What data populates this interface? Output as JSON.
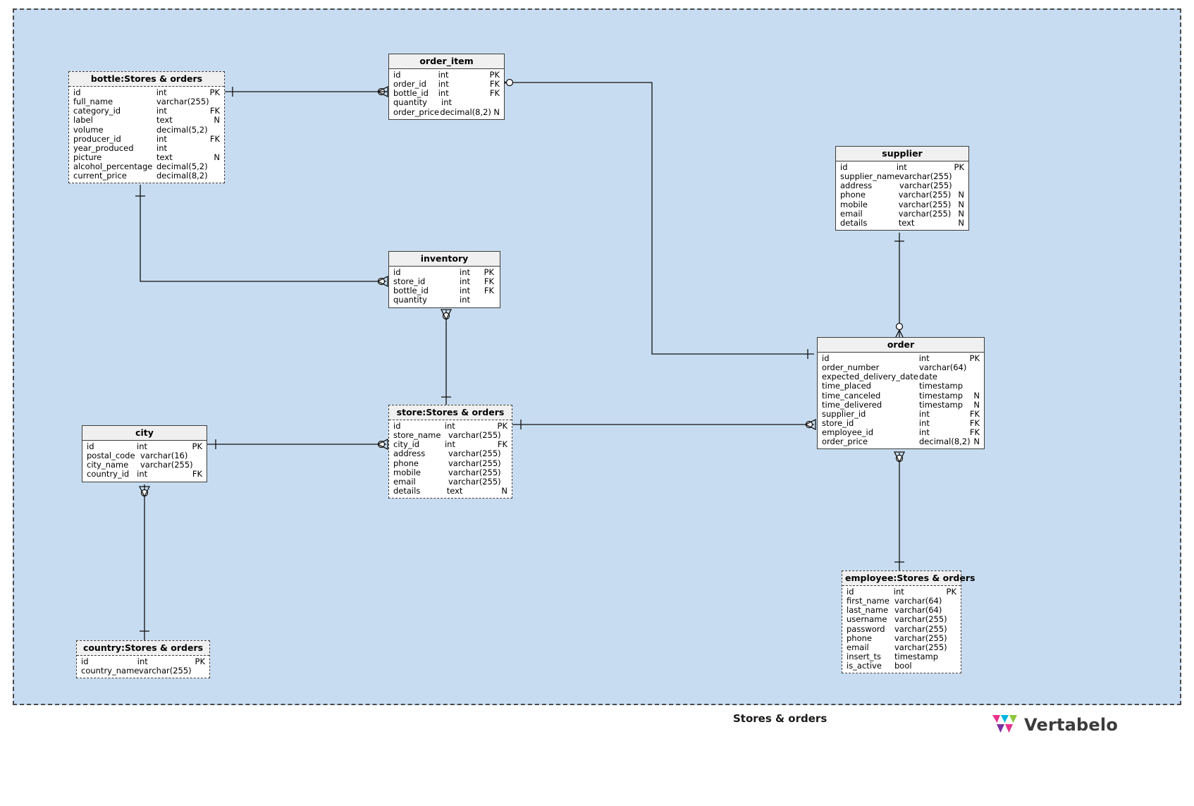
{
  "diagram": {
    "area_label": "Stores & orders",
    "background_color": "#c7dcf0",
    "border_style": "dashed",
    "brand": {
      "name": "Vertabelo",
      "logo_icon": "vertabelo-logo-icon",
      "colors": [
        "#e8318a",
        "#00b5e2",
        "#8dc63f",
        "#7b2fa0"
      ]
    }
  },
  "tables": {
    "bottle": {
      "title": "bottle:Stores & orders",
      "dashed": true,
      "columns": [
        {
          "name": "id",
          "type": "int",
          "key": "PK"
        },
        {
          "name": "full_name",
          "type": "varchar(255)",
          "key": ""
        },
        {
          "name": "category_id",
          "type": "int",
          "key": "FK"
        },
        {
          "name": "label",
          "type": "text",
          "key": "N"
        },
        {
          "name": "volume",
          "type": "decimal(5,2)",
          "key": ""
        },
        {
          "name": "producer_id",
          "type": "int",
          "key": "FK"
        },
        {
          "name": "year_produced",
          "type": "int",
          "key": ""
        },
        {
          "name": "picture",
          "type": "text",
          "key": "N"
        },
        {
          "name": "alcohol_percentage",
          "type": "decimal(5,2)",
          "key": ""
        },
        {
          "name": "current_price",
          "type": "decimal(8,2)",
          "key": ""
        }
      ]
    },
    "order_item": {
      "title": "order_item",
      "dashed": false,
      "columns": [
        {
          "name": "id",
          "type": "int",
          "key": "PK"
        },
        {
          "name": "order_id",
          "type": "int",
          "key": "FK"
        },
        {
          "name": "bottle_id",
          "type": "int",
          "key": "FK"
        },
        {
          "name": "quantity",
          "type": "int",
          "key": ""
        },
        {
          "name": "order_price",
          "type": "decimal(8,2)",
          "key": "N"
        }
      ]
    },
    "inventory": {
      "title": "inventory",
      "dashed": false,
      "columns": [
        {
          "name": "id",
          "type": "int",
          "key": "PK"
        },
        {
          "name": "store_id",
          "type": "int",
          "key": "FK"
        },
        {
          "name": "bottle_id",
          "type": "int",
          "key": "FK"
        },
        {
          "name": "quantity",
          "type": "int",
          "key": ""
        }
      ]
    },
    "store": {
      "title": "store:Stores & orders",
      "dashed": true,
      "columns": [
        {
          "name": "id",
          "type": "int",
          "key": "PK"
        },
        {
          "name": "store_name",
          "type": "varchar(255)",
          "key": ""
        },
        {
          "name": "city_id",
          "type": "int",
          "key": "FK"
        },
        {
          "name": "address",
          "type": "varchar(255)",
          "key": ""
        },
        {
          "name": "phone",
          "type": "varchar(255)",
          "key": ""
        },
        {
          "name": "mobile",
          "type": "varchar(255)",
          "key": ""
        },
        {
          "name": "email",
          "type": "varchar(255)",
          "key": ""
        },
        {
          "name": "details",
          "type": "text",
          "key": "N"
        }
      ]
    },
    "city": {
      "title": "city",
      "dashed": false,
      "columns": [
        {
          "name": "id",
          "type": "int",
          "key": "PK"
        },
        {
          "name": "postal_code",
          "type": "varchar(16)",
          "key": ""
        },
        {
          "name": "city_name",
          "type": "varchar(255)",
          "key": ""
        },
        {
          "name": "country_id",
          "type": "int",
          "key": "FK"
        }
      ]
    },
    "country": {
      "title": "country:Stores & orders",
      "dashed": true,
      "columns": [
        {
          "name": "id",
          "type": "int",
          "key": "PK"
        },
        {
          "name": "country_name",
          "type": "varchar(255)",
          "key": ""
        }
      ]
    },
    "supplier": {
      "title": "supplier",
      "dashed": false,
      "columns": [
        {
          "name": "id",
          "type": "int",
          "key": "PK"
        },
        {
          "name": "supplier_name",
          "type": "varchar(255)",
          "key": ""
        },
        {
          "name": "address",
          "type": "varchar(255)",
          "key": ""
        },
        {
          "name": "phone",
          "type": "varchar(255)",
          "key": "N"
        },
        {
          "name": "mobile",
          "type": "varchar(255)",
          "key": "N"
        },
        {
          "name": "email",
          "type": "varchar(255)",
          "key": "N"
        },
        {
          "name": "details",
          "type": "text",
          "key": "N"
        }
      ]
    },
    "order": {
      "title": "order",
      "dashed": false,
      "columns": [
        {
          "name": "id",
          "type": "int",
          "key": "PK"
        },
        {
          "name": "order_number",
          "type": "varchar(64)",
          "key": ""
        },
        {
          "name": "expected_delivery_date",
          "type": "date",
          "key": ""
        },
        {
          "name": "time_placed",
          "type": "timestamp",
          "key": ""
        },
        {
          "name": "time_canceled",
          "type": "timestamp",
          "key": "N"
        },
        {
          "name": "time_delivered",
          "type": "timestamp",
          "key": "N"
        },
        {
          "name": "supplier_id",
          "type": "int",
          "key": "FK"
        },
        {
          "name": "store_id",
          "type": "int",
          "key": "FK"
        },
        {
          "name": "employee_id",
          "type": "int",
          "key": "FK"
        },
        {
          "name": "order_price",
          "type": "decimal(8,2)",
          "key": "N"
        }
      ]
    },
    "employee": {
      "title": "employee:Stores & orders",
      "dashed": true,
      "columns": [
        {
          "name": "id",
          "type": "int",
          "key": "PK"
        },
        {
          "name": "first_name",
          "type": "varchar(64)",
          "key": ""
        },
        {
          "name": "last_name",
          "type": "varchar(64)",
          "key": ""
        },
        {
          "name": "username",
          "type": "varchar(255)",
          "key": ""
        },
        {
          "name": "password",
          "type": "varchar(255)",
          "key": ""
        },
        {
          "name": "phone",
          "type": "varchar(255)",
          "key": ""
        },
        {
          "name": "email",
          "type": "varchar(255)",
          "key": ""
        },
        {
          "name": "insert_ts",
          "type": "timestamp",
          "key": ""
        },
        {
          "name": "is_active",
          "type": "bool",
          "key": ""
        }
      ]
    }
  }
}
